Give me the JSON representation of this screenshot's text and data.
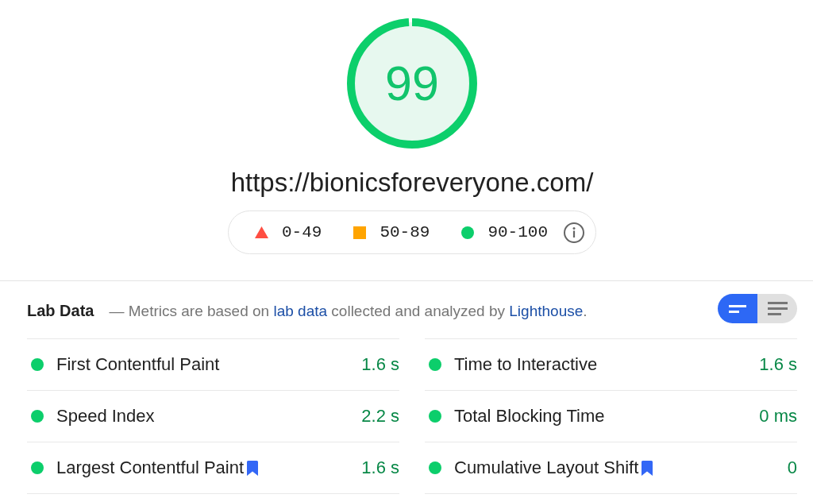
{
  "gauge": {
    "score": "99",
    "level": 0.99
  },
  "url": "https://bionicsforeveryone.com/",
  "legend": {
    "items": [
      {
        "kind": "fail",
        "color": "#ff4e42",
        "range": "0-49"
      },
      {
        "kind": "average",
        "color": "#ffa400",
        "range": "50-89"
      },
      {
        "kind": "pass",
        "color": "#0cce6b",
        "range": "90-100"
      }
    ]
  },
  "lab_data": {
    "title": "Lab Data",
    "description": [
      {
        "kind": "text",
        "text": "— Metrics are based on "
      },
      {
        "kind": "link",
        "text": "lab data"
      },
      {
        "kind": "text",
        "text": " collected and analyzed by "
      },
      {
        "kind": "link",
        "text": "Lighthouse"
      },
      {
        "kind": "text",
        "text": "."
      }
    ],
    "view_toggle": [
      {
        "kind": "summary",
        "selected": true
      },
      {
        "kind": "list",
        "selected": false
      }
    ],
    "metric_columns": [
      {
        "metrics": [
          {
            "label": "First Contentful Paint",
            "value": "1.6 s",
            "color": "#0cce6b",
            "bookmark": false
          },
          {
            "label": "Speed Index",
            "value": "2.2 s",
            "color": "#0cce6b",
            "bookmark": false
          },
          {
            "label": "Largest Contentful Paint",
            "value": "1.6 s",
            "color": "#0cce6b",
            "bookmark": true
          }
        ]
      },
      {
        "metrics": [
          {
            "label": "Time to Interactive",
            "value": "1.6 s",
            "color": "#0cce6b",
            "bookmark": false
          },
          {
            "label": "Total Blocking Time",
            "value": "0 ms",
            "color": "#0cce6b",
            "bookmark": false
          },
          {
            "label": "Cumulative Layout Shift",
            "value": "0",
            "color": "#0cce6b",
            "bookmark": true
          }
        ]
      }
    ]
  }
}
